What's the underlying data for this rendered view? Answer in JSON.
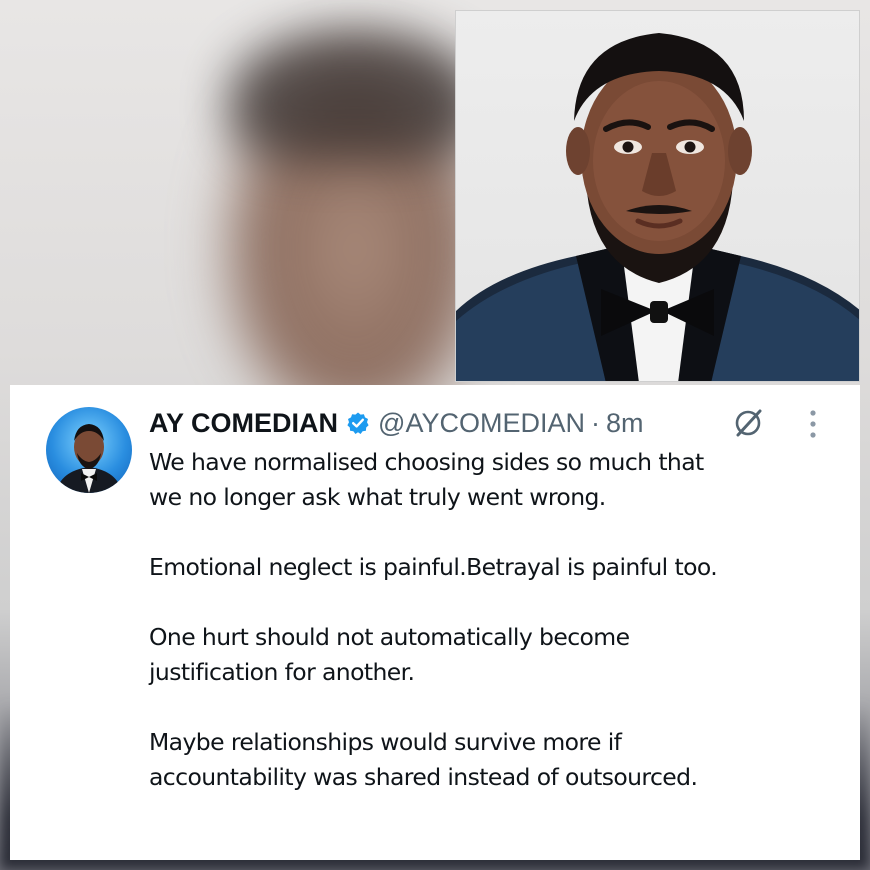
{
  "tweet": {
    "author_name": "AY COMEDIAN",
    "handle": "@AYCOMEDIAN",
    "separator": "·",
    "time": "8m",
    "verified_icon": "verified-badge-icon",
    "grok_icon": "grok-icon",
    "more_icon": "more-options-icon",
    "paragraphs": [
      [
        "We have normalised choosing sides so much that",
        "we no longer ask what truly went wrong."
      ],
      [
        "Emotional neglect is painful.Betrayal is painful too."
      ],
      [
        "One hurt should not automatically become",
        "justification for another."
      ],
      [
        "Maybe relationships would survive more if",
        "accountability was shared instead of outsourced."
      ]
    ]
  },
  "colors": {
    "verified_blue": "#1d9bf0",
    "text": "#0f1419",
    "secondary_text": "#536471"
  }
}
